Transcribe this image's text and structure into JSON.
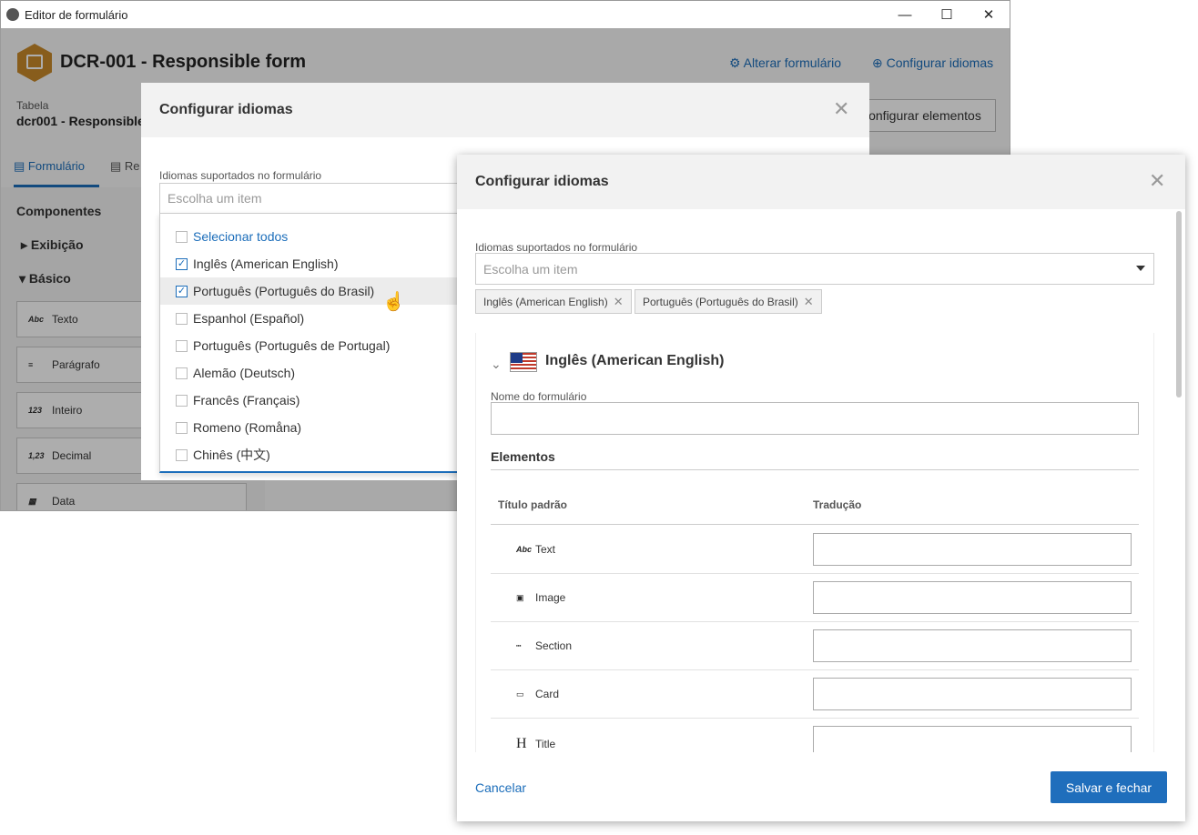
{
  "window": {
    "title": "Editor de formulário",
    "minimize": "—",
    "maximize": "☐",
    "close": "✕"
  },
  "header": {
    "form_title": "DCR-001 - Responsible form",
    "alter_link": "Alterar formulário",
    "languages_link": "Configurar idiomas",
    "config_button": "Configurar elementos",
    "table_label": "Tabela",
    "table_value": "dcr001 - Responsible"
  },
  "tabs": [
    {
      "label": "Formulário"
    },
    {
      "label": "Re"
    }
  ],
  "sidebar": {
    "title": "Componentes",
    "groups": [
      {
        "label": "Exibição"
      },
      {
        "label": "Básico"
      }
    ],
    "components": [
      {
        "icon": "Abc",
        "label": "Texto"
      },
      {
        "icon": "≡",
        "label": "Parágrafo"
      },
      {
        "icon": "123",
        "label": "Inteiro"
      },
      {
        "icon": "1,23",
        "label": "Decimal"
      },
      {
        "icon": "▦",
        "label": "Data"
      }
    ]
  },
  "modal_back": {
    "title": "Configurar idiomas",
    "field_label": "Idiomas suportados no formulário",
    "placeholder": "Escolha um item",
    "options": [
      {
        "label": "Selecionar todos",
        "checked": false
      },
      {
        "label": "Inglês (American English)",
        "checked": true
      },
      {
        "label": "Português (Português do Brasil)",
        "checked": true
      },
      {
        "label": "Espanhol (Español)",
        "checked": false
      },
      {
        "label": "Português (Português de Portugal)",
        "checked": false
      },
      {
        "label": "Alemão (Deutsch)",
        "checked": false
      },
      {
        "label": "Francês (Français)",
        "checked": false
      },
      {
        "label": "Romeno (Romåna)",
        "checked": false
      },
      {
        "label": "Chinês (中文)",
        "checked": false
      }
    ]
  },
  "modal_front": {
    "title": "Configurar idiomas",
    "field_label": "Idiomas suportados no formulário",
    "placeholder": "Escolha um item",
    "chips": [
      "Inglês (American English)",
      "Português (Português do Brasil)"
    ],
    "language_section": {
      "name": "Inglês (American English)",
      "form_name_label": "Nome do formulário",
      "form_name_value": "",
      "elements_heading": "Elementos",
      "col_default": "Título padrão",
      "col_translation": "Tradução",
      "rows": [
        {
          "icon": "Abc",
          "label": "Text"
        },
        {
          "icon": "▣",
          "label": "Image"
        },
        {
          "icon": "┅",
          "label": "Section"
        },
        {
          "icon": "▭",
          "label": "Card"
        },
        {
          "icon": "H",
          "label": "Title"
        }
      ]
    },
    "cancel_label": "Cancelar",
    "save_label": "Salvar e fechar"
  },
  "colors": {
    "accent": "#1b6dba",
    "save_button": "#1f6ebc",
    "hex_logo": "#c98a2a"
  }
}
